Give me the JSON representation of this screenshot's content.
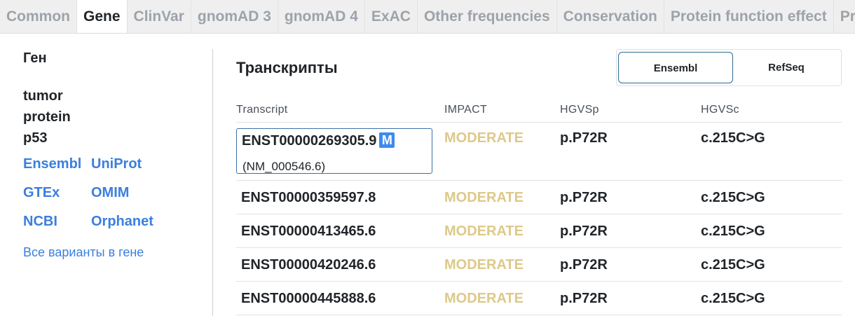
{
  "tabs": [
    "Common",
    "Gene",
    "ClinVar",
    "gnomAD 3",
    "gnomAD 4",
    "ExAC",
    "Other frequencies",
    "Conservation",
    "Protein function effect",
    "Pre"
  ],
  "active_tab": "Gene",
  "gene": {
    "section_title": "Ген",
    "name_lines": [
      "tumor",
      "protein",
      "p53"
    ],
    "links": [
      "Ensembl",
      "UniProt",
      "GTEx",
      "OMIM",
      "NCBI",
      "Orphanet"
    ],
    "all_variants_link": "Все варианты в гене"
  },
  "transcripts": {
    "heading": "Транскрипты",
    "source_toggle": {
      "selected": "Ensembl",
      "other": "RefSeq"
    },
    "columns": [
      "Transcript",
      "IMPACT",
      "HGVSp",
      "HGVSc"
    ],
    "rows": [
      {
        "transcript": "ENST00000269305.9",
        "badge": "M",
        "refseq": "(NM_000546.6)",
        "impact": "MODERATE",
        "hgvsp": "p.P72R",
        "hgvsc": "c.215C>G"
      },
      {
        "transcript": "ENST00000359597.8",
        "impact": "MODERATE",
        "hgvsp": "p.P72R",
        "hgvsc": "c.215C>G"
      },
      {
        "transcript": "ENST00000413465.6",
        "impact": "MODERATE",
        "hgvsp": "p.P72R",
        "hgvsc": "c.215C>G"
      },
      {
        "transcript": "ENST00000420246.6",
        "impact": "MODERATE",
        "hgvsp": "p.P72R",
        "hgvsc": "c.215C>G"
      },
      {
        "transcript": "ENST00000445888.6",
        "impact": "MODERATE",
        "hgvsp": "p.P72R",
        "hgvsc": "c.215C>G"
      }
    ]
  },
  "colors": {
    "link": "#3b7fdd",
    "impact_moderate": "#ddc989",
    "mane_badge": "#3d8bef"
  }
}
